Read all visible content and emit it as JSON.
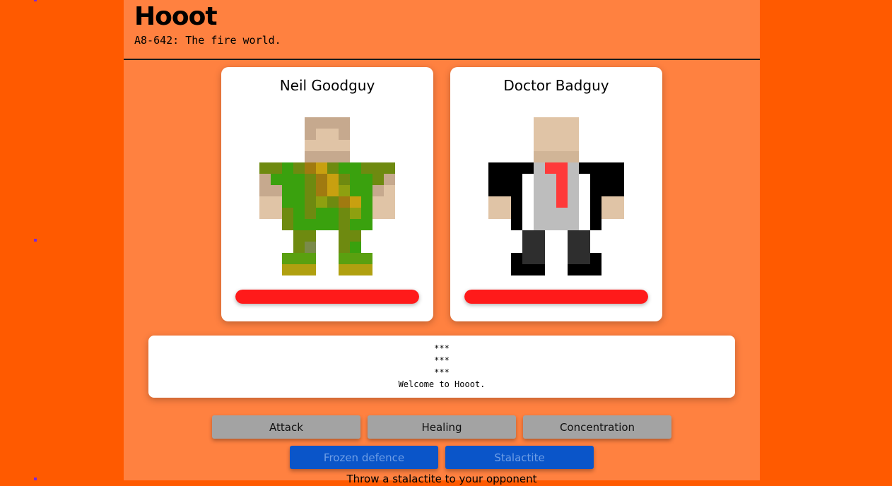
{
  "header": {
    "title": "Hooot",
    "subtitle": "A8-642: The fire world."
  },
  "players": [
    {
      "name": "Neil Goodguy",
      "sprite": "soldier-camouflage-sprite",
      "health_fraction": 1.0
    },
    {
      "name": "Doctor Badguy",
      "sprite": "suit-red-tie-sprite",
      "health_fraction": 1.0
    }
  ],
  "log": {
    "lines": [
      "***",
      "***",
      "***",
      "Welcome to Hooot."
    ]
  },
  "actions": {
    "attack": "Attack",
    "healing": "Healing",
    "concentration": "Concentration"
  },
  "spells": {
    "frozen_defence": "Frozen defence",
    "stalactite": "Stalactite",
    "description": "Throw a stalactite to your opponent"
  },
  "colors": {
    "background": "#ff5a00",
    "panel": "#ff8140",
    "health": "#ff1a1a",
    "action_button": "#a3a3a3",
    "spell_button": "#0a55c9"
  }
}
